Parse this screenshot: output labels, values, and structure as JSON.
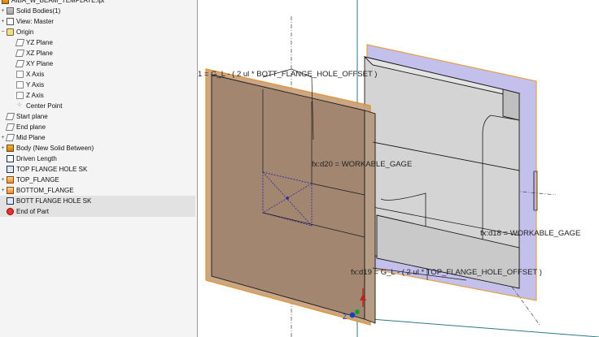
{
  "browser": {
    "items": [
      {
        "label": "AIBA_W_BEAM_TEMPLATE.ipt",
        "expander": "",
        "icon": "part-icon",
        "indent": 0
      },
      {
        "label": "Solid Bodies(1)",
        "expander": "+",
        "icon": "solid-bodies-icon",
        "indent": 1
      },
      {
        "label": "View: Master",
        "expander": "+",
        "icon": "view-icon",
        "indent": 1
      },
      {
        "label": "Origin",
        "expander": "−",
        "icon": "origin-folder-icon",
        "indent": 1
      },
      {
        "label": "YZ Plane",
        "expander": "",
        "icon": "work-plane-icon",
        "indent": 2
      },
      {
        "label": "XZ Plane",
        "expander": "",
        "icon": "work-plane-icon",
        "indent": 2
      },
      {
        "label": "XY Plane",
        "expander": "",
        "icon": "work-plane-icon",
        "indent": 2
      },
      {
        "label": "X Axis",
        "expander": "",
        "icon": "work-axis-icon",
        "indent": 2
      },
      {
        "label": "Y Axis",
        "expander": "",
        "icon": "work-axis-icon",
        "indent": 2
      },
      {
        "label": "Z Axis",
        "expander": "",
        "icon": "work-axis-icon",
        "indent": 2
      },
      {
        "label": "Center Point",
        "expander": "",
        "icon": "center-point-icon",
        "indent": 2
      },
      {
        "label": "Start plane",
        "expander": "",
        "icon": "work-plane-icon",
        "indent": 1
      },
      {
        "label": "End plane",
        "expander": "",
        "icon": "work-plane-icon",
        "indent": 1
      },
      {
        "label": "Mid Plane",
        "expander": "+",
        "icon": "work-plane-icon",
        "indent": 1
      },
      {
        "label": "Body (New Solid Between)",
        "expander": "+",
        "icon": "body-feature-icon",
        "indent": 1
      },
      {
        "label": "Driven Length",
        "expander": "",
        "icon": "driven-dimension-icon",
        "indent": 1
      },
      {
        "label": "TOP FLANGE HOLE SK",
        "expander": "",
        "icon": "sketch-icon",
        "indent": 1
      },
      {
        "label": "TOP_FLANGE",
        "expander": "+",
        "icon": "feature-icon",
        "indent": 1
      },
      {
        "label": "BOTTOM_FLANGE",
        "expander": "+",
        "icon": "feature-icon",
        "indent": 1
      },
      {
        "label": "BOTT FLANGE HOLE SK",
        "expander": "",
        "icon": "sketch-icon",
        "indent": 1,
        "selected": true
      },
      {
        "label": "End of Part",
        "expander": "",
        "icon": "end-of-part-icon",
        "indent": 1,
        "selected": true
      }
    ]
  },
  "viewport": {
    "dimensions": {
      "d_bott": "1 = G_L - ( 2 ul * BOTT_FLANGE_HOLE_OFFSET )",
      "d20": "fx:d20 = WORKABLE_GAGE",
      "d18": "fx:d18 = WORKABLE_GAGE",
      "d19": "fx:d19 = G_L - ( 2 ul * TOP_FLANGE_HOLE_OFFSET )"
    },
    "triad": {
      "z": "Z"
    },
    "colors": {
      "plane_fill": "#c8a27e",
      "plane_edge": "#e0902a",
      "back_plane": "#b9b6e8",
      "beam_face": "#cdcdcd",
      "beam_edge": "#1a1a1a",
      "sketch_line": "#2a2aa0",
      "axis_line": "#2b7a86"
    }
  }
}
